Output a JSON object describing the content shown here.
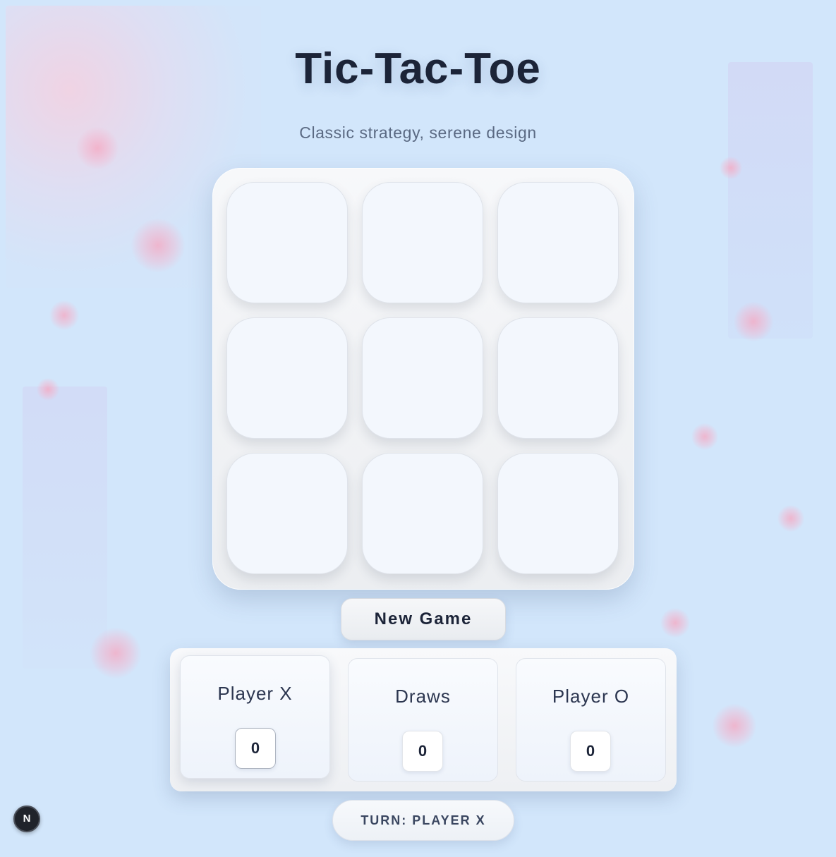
{
  "app": {
    "title": "Tic-Tac-Toe",
    "subtitle": "Classic strategy, serene design"
  },
  "board": {
    "cells": [
      "",
      "",
      "",
      "",
      "",
      "",
      "",
      "",
      ""
    ]
  },
  "controls": {
    "new_game_label": "New Game"
  },
  "scoreboard": {
    "player_x": {
      "label": "Player X",
      "score": "0"
    },
    "draws": {
      "label": "Draws",
      "score": "0"
    },
    "player_o": {
      "label": "Player O",
      "score": "0"
    }
  },
  "status": {
    "turn_text": "TURN: PLAYER X"
  },
  "dev_badge": {
    "letter": "N"
  },
  "colors": {
    "background": "#d2e6fb",
    "title": "#1c2438",
    "subtitle": "#5b6a83",
    "cell": "#f3f7fd",
    "accent_pink": "#f5aac3"
  }
}
